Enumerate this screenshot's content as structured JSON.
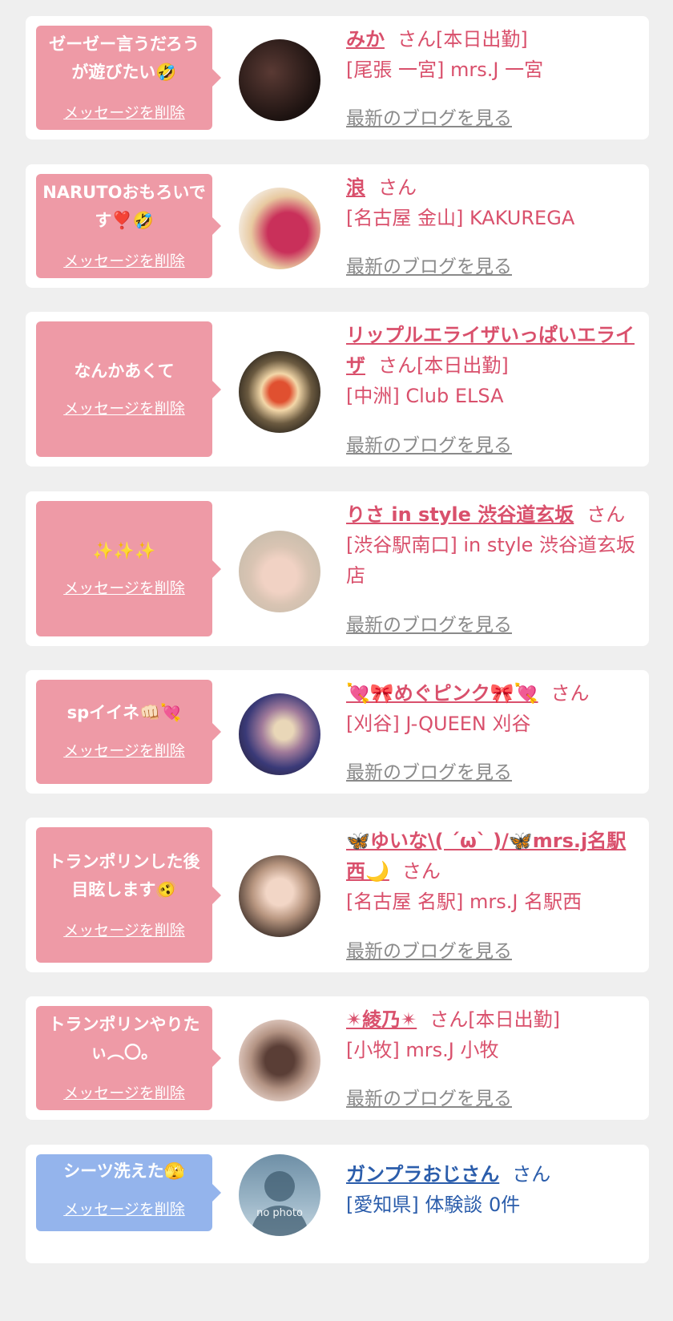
{
  "cards": [
    {
      "message": "ゼーゼー言うだろうが遊びたい🤣",
      "delete": "メッセージを削除",
      "name": "みか",
      "san": "さん",
      "status": "[本日出勤]",
      "shop": "[尾張 一宮] mrs.J 一宮",
      "blog": "最新のブログを見る"
    },
    {
      "message": "NARUTOおもろいです❣️🤣",
      "delete": "メッセージを削除",
      "name": "浪",
      "san": "さん",
      "status": "",
      "shop": "[名古屋 金山] KAKUREGA",
      "blog": "最新のブログを見る"
    },
    {
      "message": "なんかあくて",
      "delete": "メッセージを削除",
      "name": "リップルエライザいっぱいエライザ",
      "san": "さん",
      "status": "[本日出勤]",
      "shop": "[中洲] Club ELSA",
      "blog": "最新のブログを見る"
    },
    {
      "message": "✨✨✨",
      "delete": "メッセージを削除",
      "name": "りさ in style 渋谷道玄坂",
      "san": "さん",
      "status": "",
      "shop": "[渋谷駅南口] in style 渋谷道玄坂店",
      "blog": "最新のブログを見る"
    },
    {
      "message": "spイイネ👊🏻💘",
      "delete": "メッセージを削除",
      "name": "💘🎀めぐピンク🎀💘",
      "san": "さん",
      "status": "",
      "shop": "[刈谷] J-QUEEN 刈谷",
      "blog": "最新のブログを見る"
    },
    {
      "message": "トランポリンした後目眩します🫨",
      "delete": "メッセージを削除",
      "name": "🦋ゆいな\\( ´ω` )/🦋mrs.j名駅西🌙",
      "san": "さん",
      "status": "",
      "shop": "[名古屋 名駅] mrs.J 名駅西",
      "blog": "最新のブログを見る"
    },
    {
      "message": "トランポリンやりたぃ︵〇。",
      "delete": "メッセージを削除",
      "name": "✴綾乃✴",
      "san": "さん",
      "status": "[本日出勤]",
      "shop": "[小牧] mrs.J 小牧",
      "blog": "最新のブログを見る"
    },
    {
      "message": "シーツ洗えた🫣",
      "delete": "メッセージを削除",
      "name": "ガンプラおじさん",
      "san": "さん",
      "status": "",
      "shop": "[愛知県] 体験談 0件",
      "no_photo": "no photo"
    }
  ],
  "colors": {
    "pink_bubble": "#ee9aa6",
    "blue_bubble": "#94b4ec",
    "pink_text": "#d9506c",
    "blue_text": "#2b5dab",
    "blog_gray": "#8a8a8a"
  }
}
